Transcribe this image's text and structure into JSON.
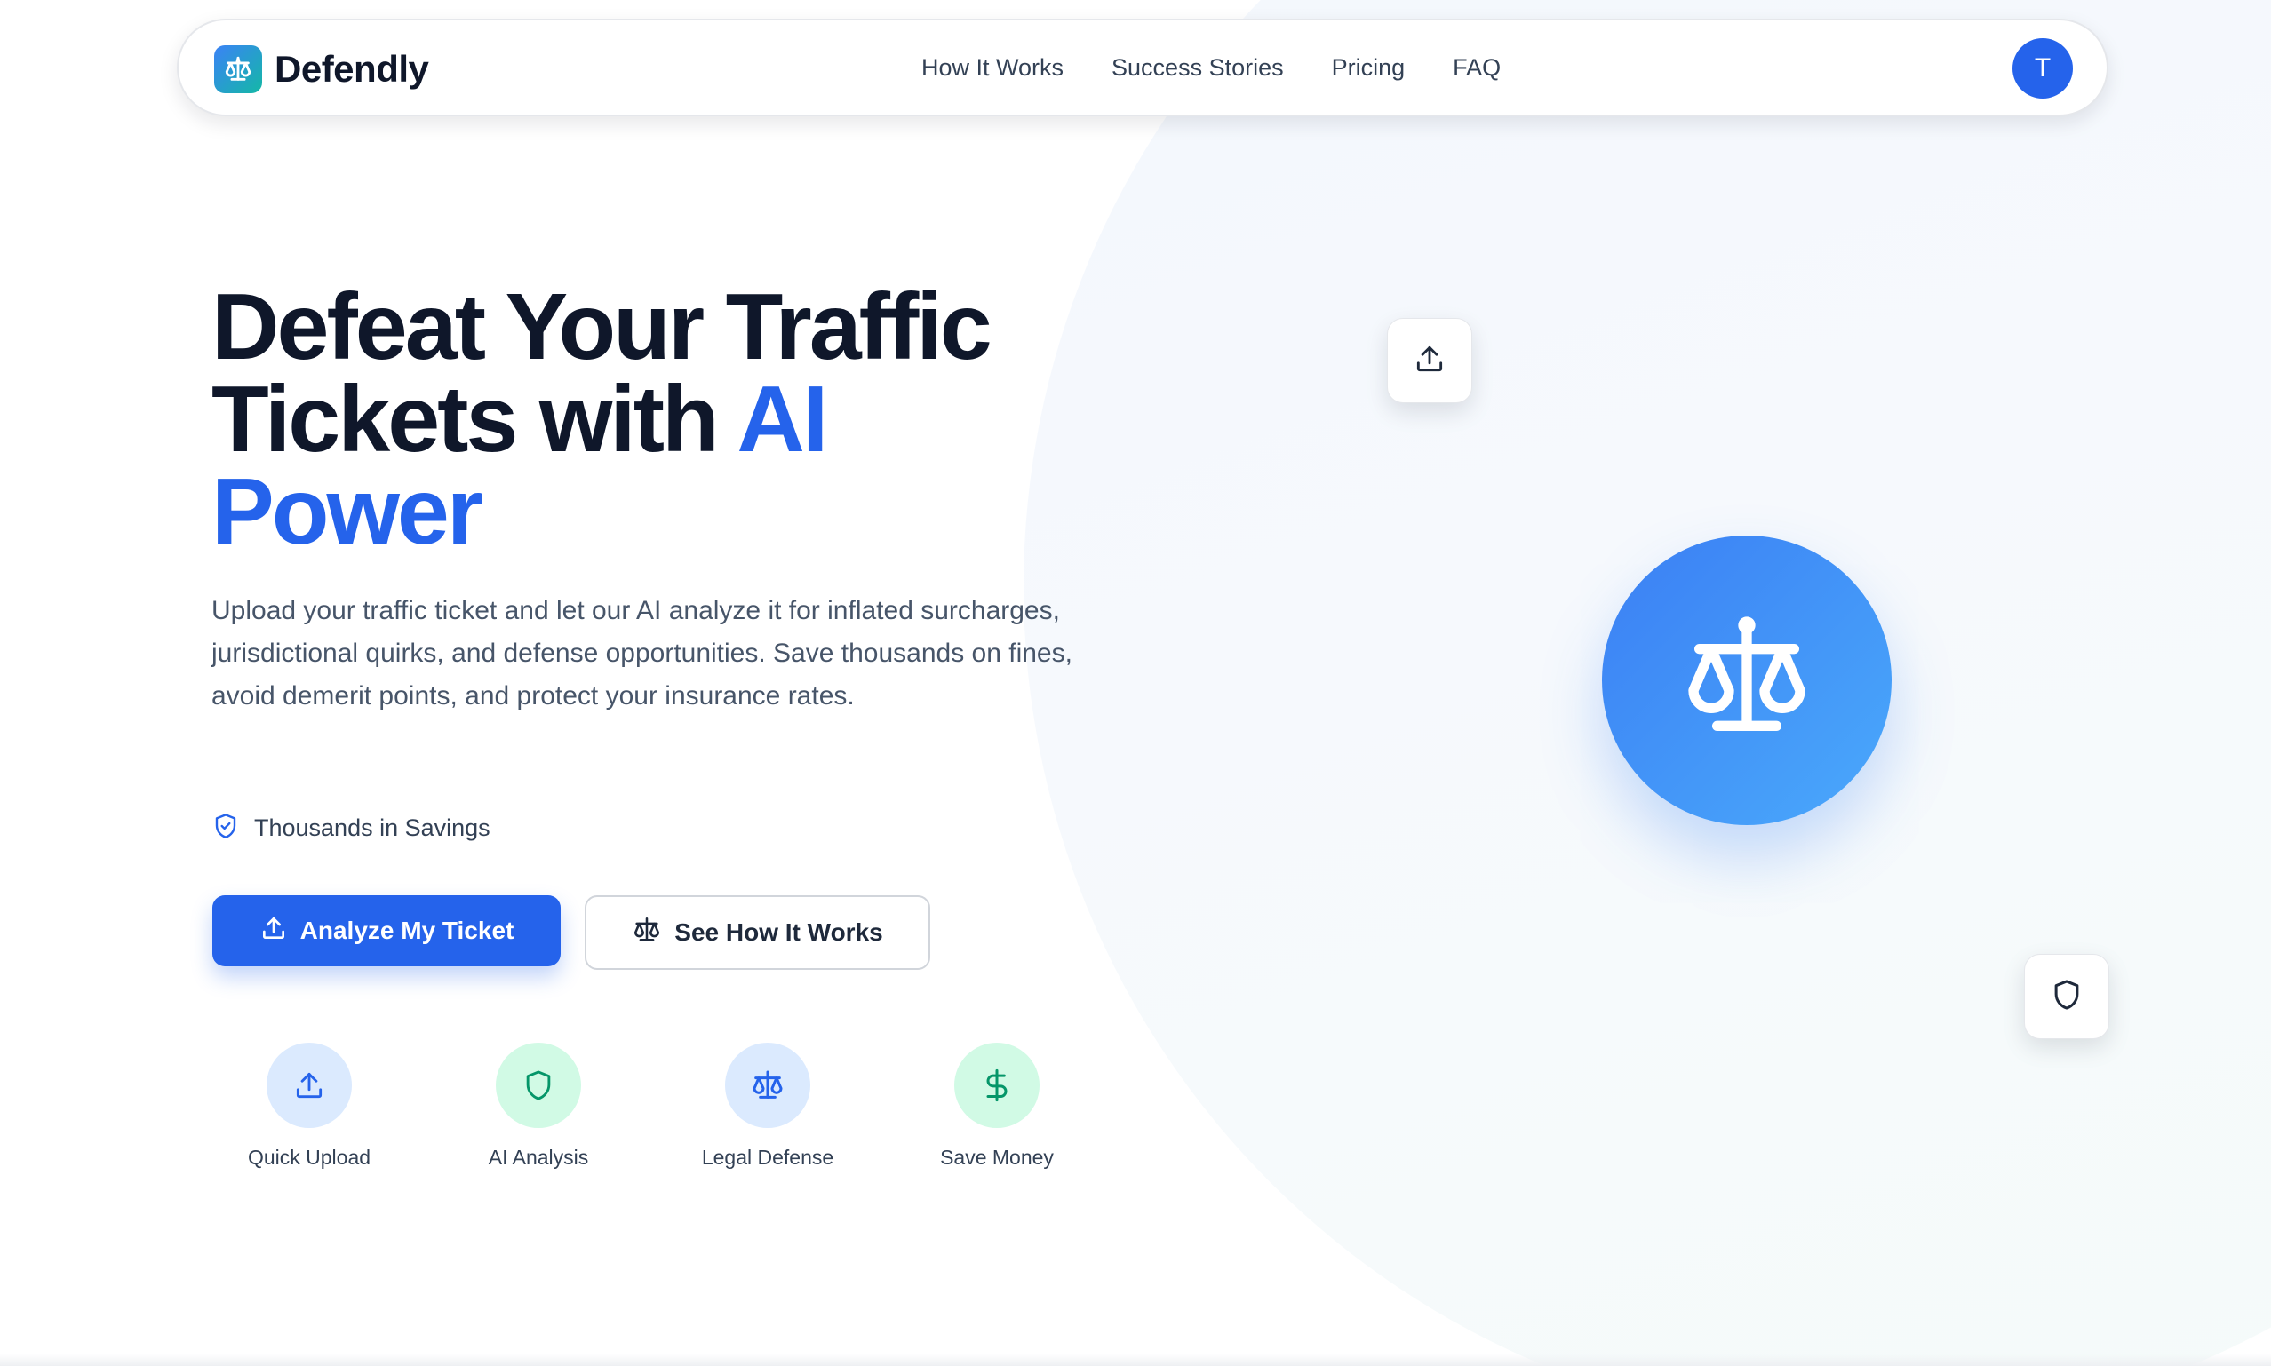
{
  "nav": {
    "brand": "Defendly",
    "links": [
      "How It Works",
      "Success Stories",
      "Pricing",
      "FAQ"
    ],
    "avatar_initial": "T"
  },
  "hero": {
    "title_line1": "Defeat Your Traffic",
    "title_line2": "Tickets with",
    "title_accent1": "AI",
    "title_accent2": "Power",
    "description": "Upload your traffic ticket and let our AI analyze it for inflated surcharges, jurisdictional quirks, and defense opportunities. Save thousands on fines, avoid demerit points, and protect your insurance rates.",
    "savings_badge": "Thousands in Savings",
    "primary_cta": "Analyze My Ticket",
    "secondary_cta": "See How It Works"
  },
  "features": [
    {
      "label": "Quick Upload",
      "icon": "upload-icon"
    },
    {
      "label": "AI Analysis",
      "icon": "shield-icon"
    },
    {
      "label": "Legal Defense",
      "icon": "scale-icon"
    },
    {
      "label": "Save Money",
      "icon": "dollar-icon"
    }
  ],
  "colors": {
    "accent": "#2563eb",
    "text_dark": "#0f172a",
    "text_muted": "#475569",
    "feature_blue_bg": "#dbeafe",
    "feature_green_bg": "#d1fae5",
    "feature_green_fg": "#059669"
  }
}
